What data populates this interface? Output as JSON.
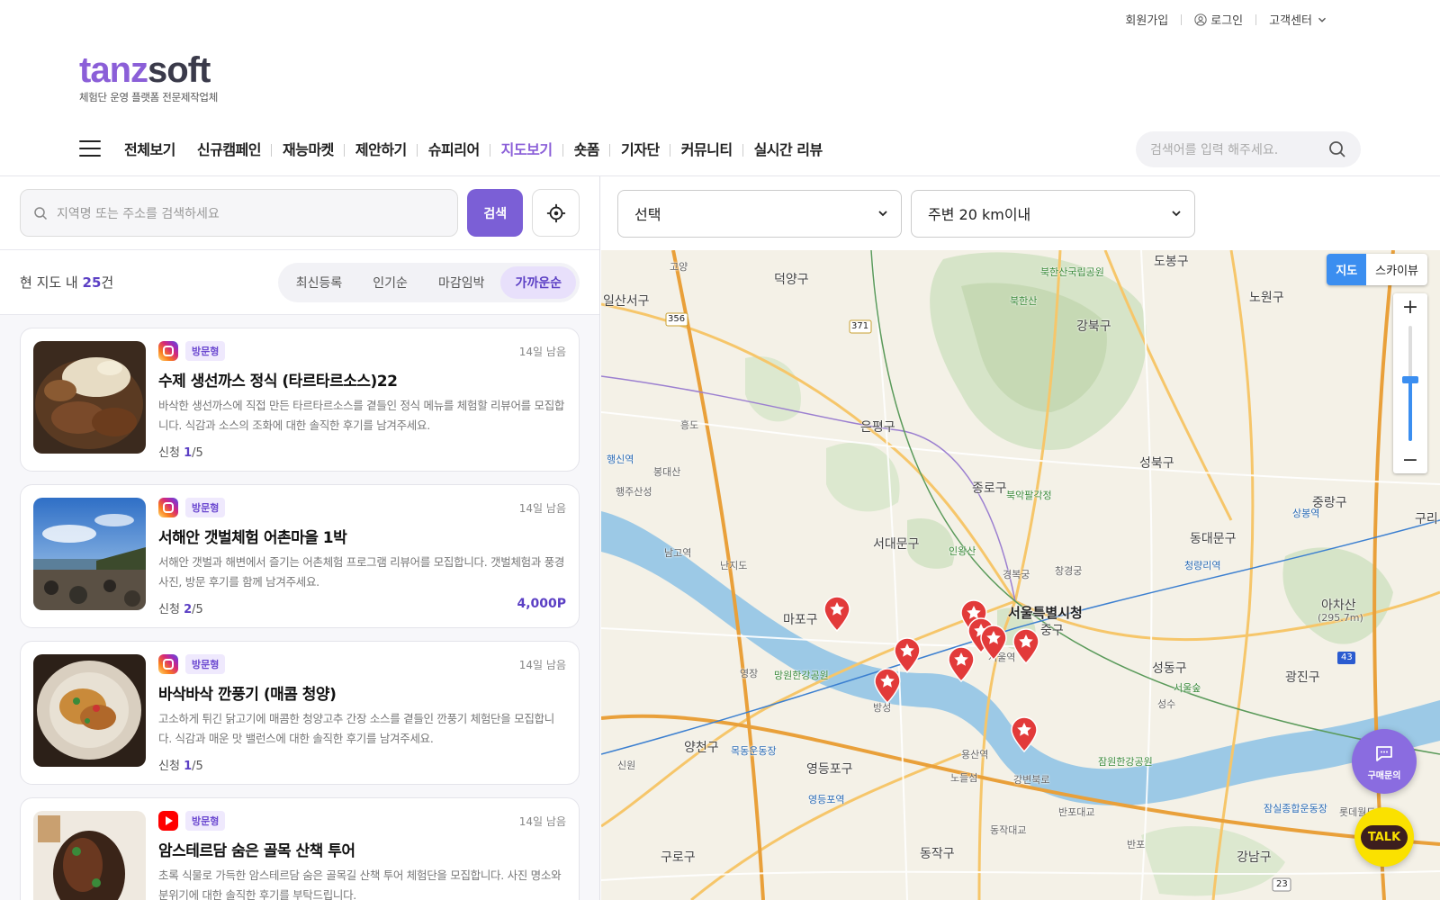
{
  "util": {
    "signup": "회원가입",
    "login": "로그인",
    "support": "고객센터"
  },
  "logo": {
    "part1": "tanz",
    "part2": "soft",
    "tagline": "체험단 운영 플랫폼 전문제작업체"
  },
  "nav": {
    "items": [
      {
        "label": "전체보기",
        "active": false
      },
      {
        "label": "신규캠페인",
        "active": false
      },
      {
        "label": "재능마켓",
        "active": false
      },
      {
        "label": "제안하기",
        "active": false
      },
      {
        "label": "슈피리어",
        "active": false
      },
      {
        "label": "지도보기",
        "active": true
      },
      {
        "label": "숏폼",
        "active": false
      },
      {
        "label": "기자단",
        "active": false
      },
      {
        "label": "커뮤니티",
        "active": false
      },
      {
        "label": "실시간 리뷰",
        "active": false
      }
    ],
    "search_placeholder": "검색어를 입력 해주세요."
  },
  "left": {
    "search_placeholder": "지역명 또는 주소를 검색하세요",
    "search_button": "검색",
    "count_prefix": "현 지도 내 ",
    "count_value": "25",
    "count_suffix": "건",
    "sorts": [
      "최신등록",
      "인기순",
      "마감임박",
      "가까운순"
    ],
    "active_sort": "가까운순",
    "cards": [
      {
        "platform": "instagram",
        "badge": "방문형",
        "dday": "14일 남음",
        "title": "수제 생선까스 정식 (타르타르소스)22",
        "desc": "바삭한 생선까스에 직접 만든 타르타르소스를 곁들인 정식 메뉴를 체험할 리뷰어를 모집합니다. 식감과 소스의 조화에 대한 솔직한 후기를 남겨주세요.",
        "apply_label": "신청 ",
        "apply_count": "1",
        "apply_total": "/5",
        "point": ""
      },
      {
        "platform": "instagram",
        "badge": "방문형",
        "dday": "14일 남음",
        "title": "서해안 갯벌체험 어촌마을 1박",
        "desc": "서해안 갯벌과 해변에서 즐기는 어촌체험 프로그램 리뷰어를 모집합니다. 갯벌체험과 풍경 사진, 방문 후기를 함께 남겨주세요.",
        "apply_label": "신청 ",
        "apply_count": "2",
        "apply_total": "/5",
        "point": "4,000P"
      },
      {
        "platform": "instagram",
        "badge": "방문형",
        "dday": "14일 남음",
        "title": "바삭바삭 깐풍기 (매콤 청양)",
        "desc": "고소하게 튀긴 닭고기에 매콤한 청양고추 간장 소스를 곁들인 깐풍기 체험단을 모집합니다. 식감과 매운 맛 밸런스에 대한 솔직한 후기를 남겨주세요.",
        "apply_label": "신청 ",
        "apply_count": "1",
        "apply_total": "/5",
        "point": ""
      },
      {
        "platform": "youtube",
        "badge": "방문형",
        "dday": "14일 남음",
        "title": "암스테르담 숨은 골목 산책 투어",
        "desc": "초록 식물로 가득한 암스테르담 숨은 골목길 산책 투어 체험단을 모집합니다. 사진 명소와 분위기에 대한 솔직한 후기를 부탁드립니다.",
        "apply_label": "",
        "apply_count": "",
        "apply_total": "",
        "point": ""
      }
    ]
  },
  "map": {
    "category_select": "선택",
    "radius_select": "주변 20 km이내",
    "type_map": "지도",
    "type_sky": "스카이뷰",
    "zoom_in": "+",
    "zoom_out": "−",
    "labels": [
      "덕양구",
      "고양",
      "일산서구",
      "강북구",
      "도봉구",
      "노원구",
      "북한산",
      "북한산국립공원",
      "은평구",
      "흥도",
      "행신역",
      "봉대산",
      "행주산성",
      "종로구",
      "북악팔각정",
      "성북구",
      "중랑구",
      "상봉역",
      "구리",
      "서대문구",
      "인왕산",
      "경복궁",
      "창경궁",
      "동대문구",
      "청량리역",
      "난지도",
      "남고역",
      "마포구",
      "서울특별시청",
      "중구",
      "아차산",
      "(295.7m)",
      "서울역",
      "성동구",
      "광진구",
      "서울숲",
      "망원한강공원",
      "영장",
      "방성",
      "양천구",
      "목동운동장",
      "용산역",
      "성수",
      "잠원한강공원",
      "신원",
      "영등포구",
      "노들섬",
      "강변북로",
      "영등포역",
      "반포대교",
      "동작대교",
      "잠실종합운동장",
      "롯데월드",
      "구로구",
      "동작구",
      "강남구",
      "반포",
      "356",
      "371",
      "43",
      "23"
    ],
    "markers_count": 9
  },
  "floating": {
    "inquiry": "구매문의",
    "talk": "TALK"
  },
  "colors": {
    "accent": "#7b5fd6",
    "brand_purple": "#8b5fd8",
    "map_blue": "#3b8ef0",
    "marker_red": "#e23a3a"
  }
}
